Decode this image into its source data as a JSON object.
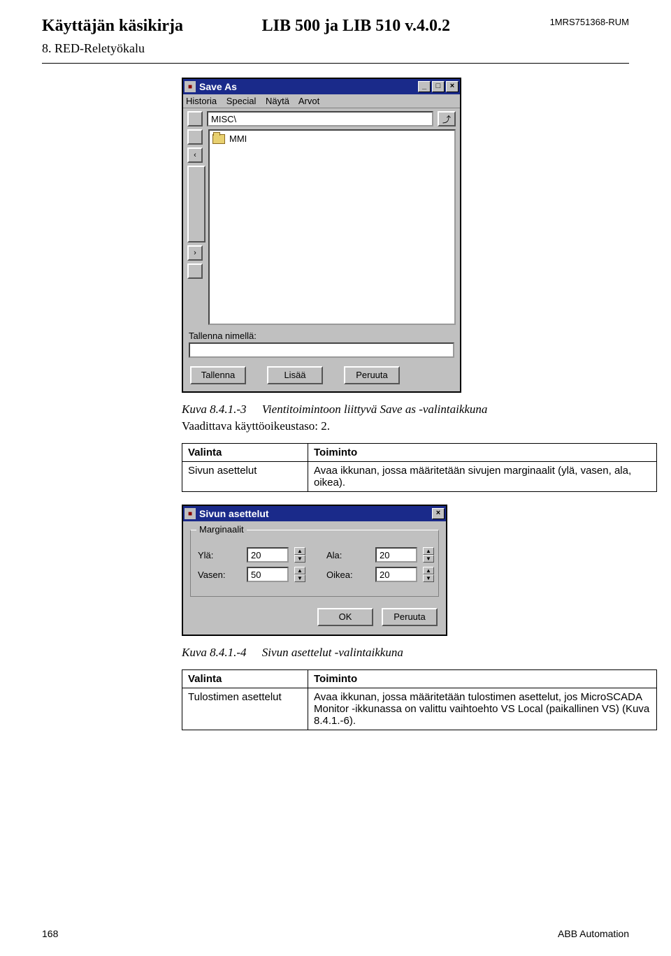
{
  "header": {
    "left": "Käyttäjän käsikirja",
    "center": "LIB 500 ja LIB 510 v.4.0.2",
    "right": "1MRS751368-RUM",
    "section": "8. RED-Reletyökalu"
  },
  "saveAsDialog": {
    "title": "Save As",
    "menus": [
      "Historia",
      "Special",
      "Näytä",
      "Arvot"
    ],
    "path": "MISC\\",
    "folderItems": [
      "MMI"
    ],
    "saveLabel": "Tallenna nimellä:",
    "saveValue": "",
    "buttons": [
      "Tallenna",
      "Lisää",
      "Peruuta"
    ]
  },
  "caption1": {
    "num": "Kuva 8.4.1.-3",
    "text": "Vientitoimintoon liittyvä Save as -valintaikkuna",
    "access": "Vaadittava käyttöoikeustaso: 2."
  },
  "table1": {
    "headers": [
      "Valinta",
      "Toiminto"
    ],
    "rows": [
      [
        "Sivun asettelut",
        "Avaa ikkunan, jossa määritetään sivujen marginaalit (ylä, vasen, ala, oikea)."
      ]
    ]
  },
  "pageSetupDialog": {
    "title": "Sivun asettelut",
    "groupLabel": "Marginaalit",
    "fields": {
      "top": {
        "label": "Ylä:",
        "value": "20"
      },
      "bottom": {
        "label": "Ala:",
        "value": "20"
      },
      "left": {
        "label": "Vasen:",
        "value": "50"
      },
      "right": {
        "label": "Oikea:",
        "value": "20"
      }
    },
    "buttons": [
      "OK",
      "Peruuta"
    ]
  },
  "caption2": {
    "num": "Kuva 8.4.1.-4",
    "text": "Sivun asettelut -valintaikkuna"
  },
  "table2": {
    "headers": [
      "Valinta",
      "Toiminto"
    ],
    "rows": [
      [
        "Tulostimen asettelut",
        "Avaa ikkunan, jossa määritetään tulostimen asettelut, jos MicroSCADA Monitor -ikkunassa on valittu vaihtoehto VS Local (paikallinen VS) (Kuva 8.4.1.-6)."
      ]
    ]
  },
  "footer": {
    "page": "168",
    "brand": "ABB Automation"
  }
}
